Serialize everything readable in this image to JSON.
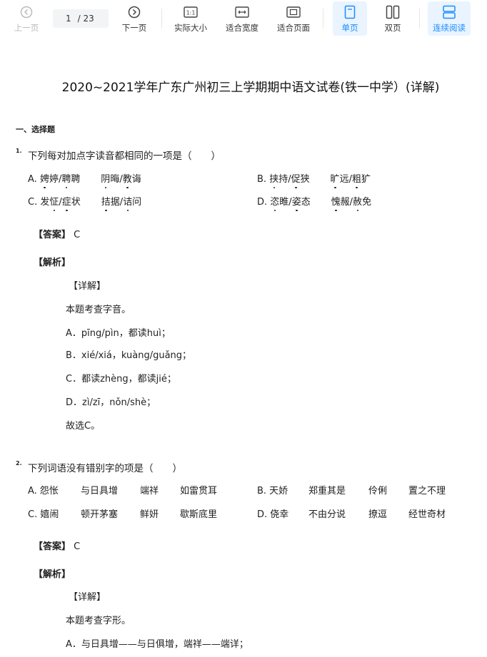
{
  "toolbar": {
    "prev": "上一页",
    "page_current": "1",
    "page_total": "/ 23",
    "next": "下一页",
    "actual_size": "实际大小",
    "fit_width": "适合宽度",
    "fit_page": "适合页面",
    "single_page": "单页",
    "double_page": "双页",
    "continuous": "连续阅读",
    "accent_color": "#1a8cff"
  },
  "doc": {
    "title": "2020~2021学年广东广州初三上学期期中语文试卷(铁一中学）(详解)",
    "section": "一、选择题",
    "q1": {
      "num": "1.",
      "text": "下列每对加点字读音都相同的一项是（　　）",
      "a_label": "A.",
      "a1": [
        "娉",
        "婷/",
        "",
        "聘"
      ],
      "b_label": "B.",
      "c_label": "C.",
      "d_label": "D.",
      "answer_label": "【答案】",
      "answer": "C",
      "analysis_label": "【解析】",
      "detail_label": "【详解】",
      "lines": [
        "本题考查字音。",
        "A．pīng/pìn，都读huì；",
        "B．xié/xiá，kuàng/guǎng；",
        "C．都读zhèng，都读jié；",
        "D．zì/zī，nǒn/shè；",
        "故选C。"
      ]
    },
    "q2": {
      "num": "2.",
      "text": "下列词语没有错别字的项是（　　）",
      "options_row1": [
        "A. 怨怅",
        "与日具增",
        "端祥",
        "如雷贯耳",
        "B. 天娇",
        "郑重其是",
        "伶俐",
        "置之不理"
      ],
      "options_row2": [
        "C. 嬉闹",
        "顿开茅塞",
        "鲜妍",
        "歇斯底里",
        "D. 侥幸",
        "不由分说",
        "撩逗",
        "经世奇材"
      ],
      "answer_label": "【答案】",
      "answer": "C",
      "analysis_label": "【解析】",
      "detail_label": "【详解】",
      "lines": [
        "本题考查字形。",
        "A．与日具增——与日俱增，端祥——端详；"
      ]
    }
  }
}
